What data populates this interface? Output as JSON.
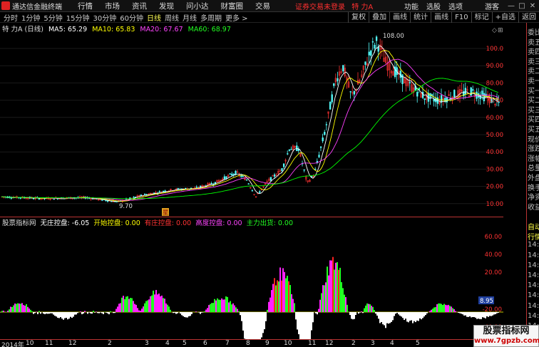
{
  "app": {
    "title": "通达信金融终端",
    "menus": [
      "行情",
      "市场",
      "资讯",
      "发现",
      "问小达",
      "财富圈",
      "交易"
    ],
    "notice": "证券交易未登录",
    "stock_tag": "特 力A",
    "right_menus": [
      "功能",
      "选股",
      "选项"
    ],
    "user": "游客",
    "win_buttons": [
      "—",
      "□",
      "✕"
    ]
  },
  "periods": [
    "分时",
    "1分钟",
    "5分钟",
    "15分钟",
    "30分钟",
    "60分钟",
    "日线",
    "周线",
    "月线",
    "多周期",
    "更多 >"
  ],
  "active_period": "日线",
  "tools": [
    "复权",
    "叠加",
    "画线",
    "统计",
    "画线",
    "F10",
    "标记",
    "+自选",
    "返回"
  ],
  "main_legend": {
    "title": "特 力A (日线)",
    "ma5": "MA5: 65.29",
    "ma10": "MA10: 65.83",
    "ma20": "MA20: 67.67",
    "ma60": "MA60: 68.97"
  },
  "price_axis": [
    "100.0",
    "90.00",
    "80.00",
    "70.00",
    "60.00",
    "50.00",
    "40.00",
    "30.00",
    "20.00",
    "10.00"
  ],
  "high_label": "108.00",
  "low_label": "9.70",
  "event_marker": "星",
  "indicator_legend": {
    "site": "股票指标网",
    "a": "无庄控盘: -6.05",
    "b": "开始控盘: 0.00",
    "c": "有庄控盘: 0.00",
    "d": "高度控盘: 0.00",
    "e": "主力出货: 0.00"
  },
  "ind_axis": [
    "60.00",
    "40.00",
    "20.00",
    "-20.00",
    "-40.00"
  ],
  "ind_current": "8.95",
  "x_axis": [
    "2014年",
    "10",
    "11",
    "12",
    "2",
    "3",
    "4",
    "5",
    "6",
    "7",
    "8",
    "9",
    "10",
    "11",
    "12",
    "2",
    "3",
    "4",
    "5"
  ],
  "side_labels": [
    "委比",
    "卖五",
    "卖四",
    "卖三",
    "卖二",
    "卖一",
    "买一",
    "买二",
    "买三",
    "买四",
    "买五",
    "现价",
    "涨跌",
    "涨幅",
    "总量",
    "外盘",
    "换手",
    "净资",
    "收益",
    "自动",
    "行情",
    "14:50",
    "14:50",
    "14:50",
    "14:50",
    "14:50",
    "14:50",
    "14:50",
    "14:50",
    "14:50",
    "14:50"
  ],
  "watermark": {
    "line1": "股票指标网",
    "line2": "www.7gpzb.com"
  },
  "colors": {
    "up": "#ff3232",
    "down": "#54ffff",
    "ma5": "#ffffff",
    "ma10": "#ffff00",
    "ma20": "#ff40ff",
    "ma60": "#00ff00",
    "bar_red": "#ff2020",
    "bar_magenta": "#ff22ff",
    "bar_green": "#22ff22",
    "bar_white": "#ffffff"
  }
}
